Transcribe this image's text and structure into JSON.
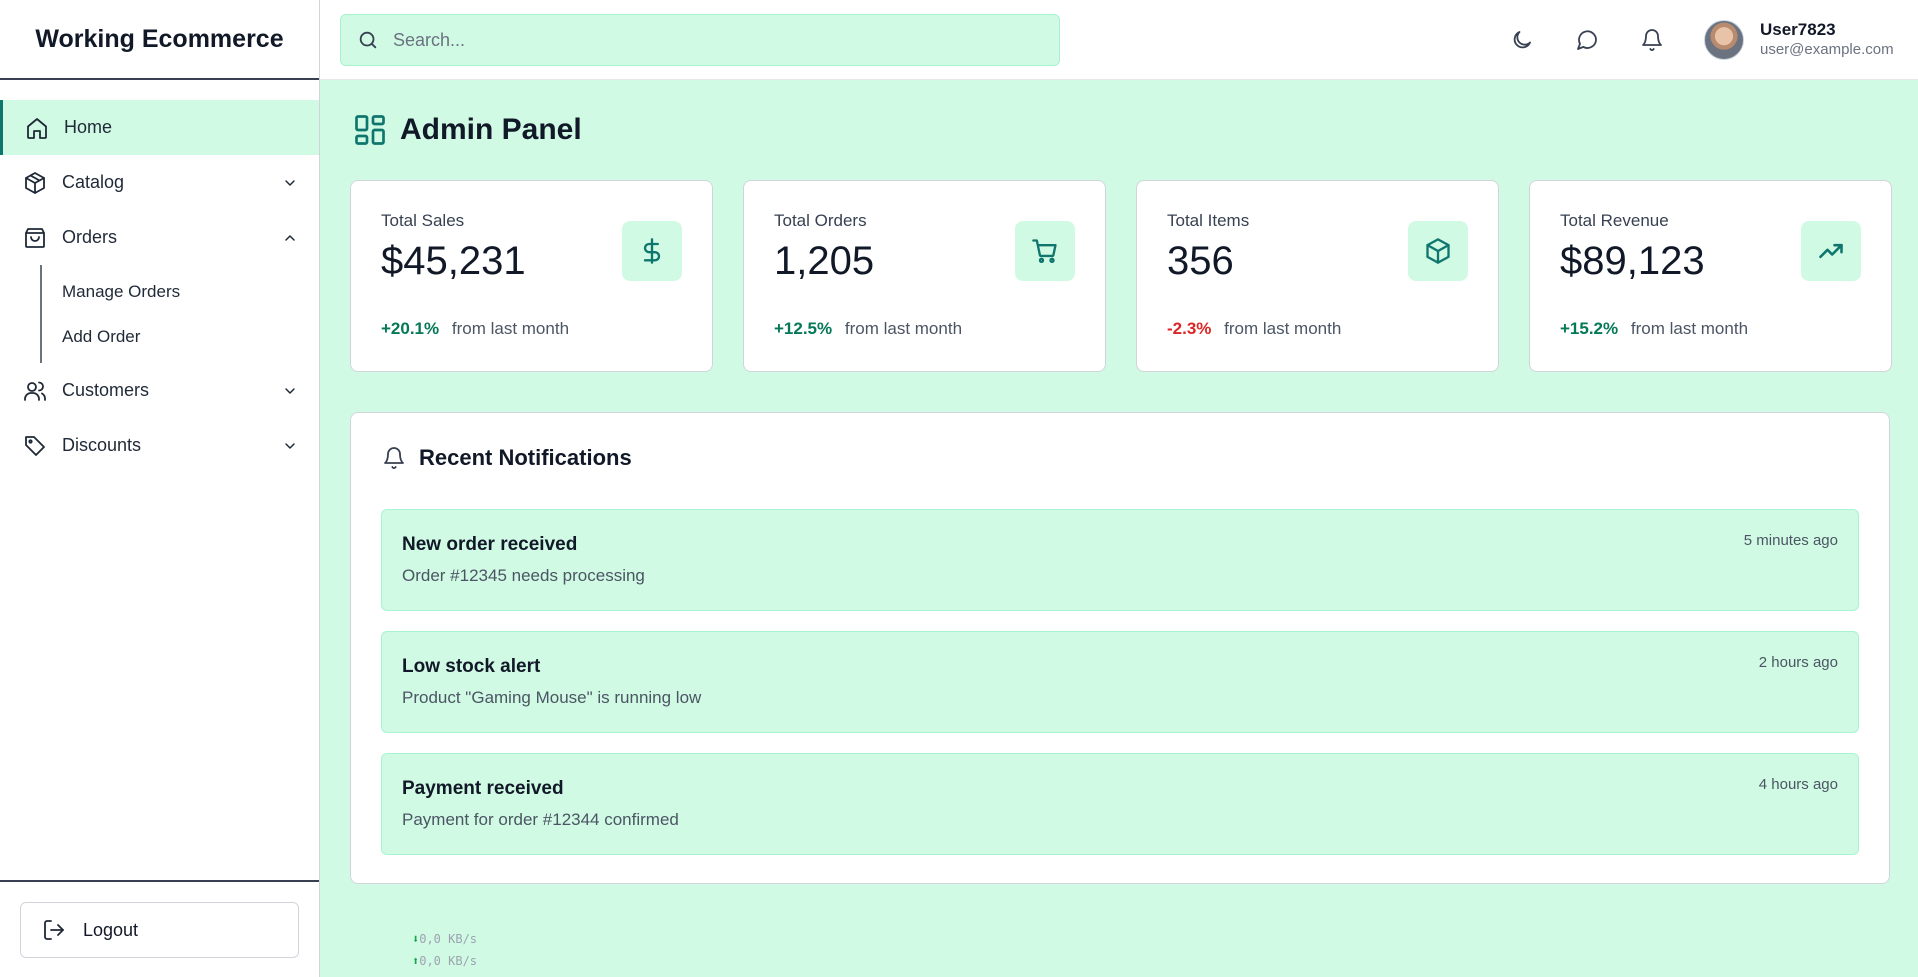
{
  "brand": {
    "title": "Working Ecommerce"
  },
  "sidebar": {
    "items": [
      {
        "label": "Home",
        "icon": "home-icon",
        "active": true
      },
      {
        "label": "Catalog",
        "icon": "package-icon",
        "expanded": false
      },
      {
        "label": "Orders",
        "icon": "shopping-bag-icon",
        "expanded": true,
        "children": [
          {
            "label": "Manage Orders"
          },
          {
            "label": "Add Order"
          }
        ]
      },
      {
        "label": "Customers",
        "icon": "users-icon",
        "expanded": false
      },
      {
        "label": "Discounts",
        "icon": "tag-icon",
        "expanded": false
      }
    ],
    "logout_label": "Logout"
  },
  "header": {
    "search_placeholder": "Search...",
    "user": {
      "name": "User7823",
      "email": "user@example.com"
    }
  },
  "main": {
    "title": "Admin Panel",
    "cards": [
      {
        "label": "Total Sales",
        "value": "$45,231",
        "change": "+20.1%",
        "change_note": "from last month",
        "trend": "up",
        "icon": "dollar-icon"
      },
      {
        "label": "Total Orders",
        "value": "1,205",
        "change": "+12.5%",
        "change_note": "from last month",
        "trend": "up",
        "icon": "cart-icon"
      },
      {
        "label": "Total Items",
        "value": "356",
        "change": "-2.3%",
        "change_note": "from last month",
        "trend": "down",
        "icon": "box-icon"
      },
      {
        "label": "Total Revenue",
        "value": "$89,123",
        "change": "+15.2%",
        "change_note": "from last month",
        "trend": "up",
        "icon": "trending-up-icon"
      }
    ],
    "notifications": {
      "title": "Recent Notifications",
      "items": [
        {
          "title": "New order received",
          "description": "Order #12345 needs processing",
          "time": "5 minutes ago"
        },
        {
          "title": "Low stock alert",
          "description": "Product \"Gaming Mouse\" is running low",
          "time": "2 hours ago"
        },
        {
          "title": "Payment received",
          "description": "Payment for order #12344 confirmed",
          "time": "4 hours ago"
        }
      ]
    }
  },
  "netspeed": {
    "down": "0,0 KB/s",
    "up": "0,0 KB/s"
  },
  "colors": {
    "accent": "#0f766e",
    "accent_bg": "#d1fae5",
    "positive": "#047857",
    "negative": "#dc2626"
  }
}
